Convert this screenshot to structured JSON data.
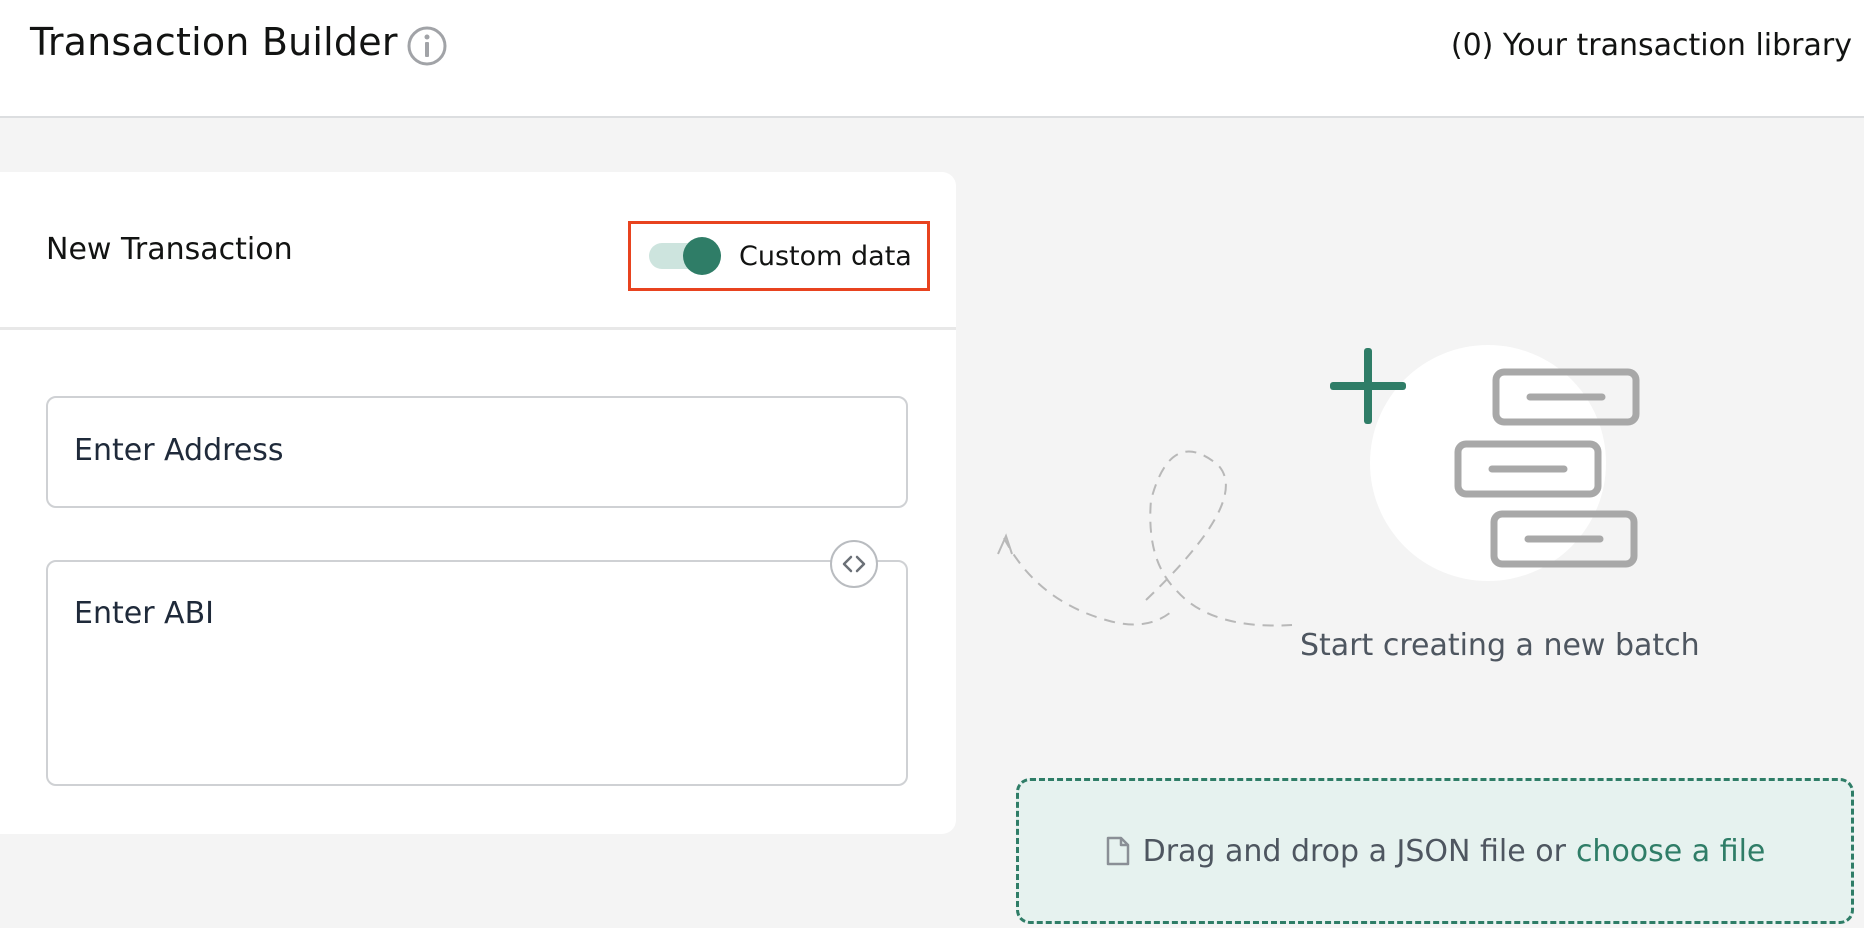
{
  "header": {
    "title": "Transaction Builder",
    "library_link": "(0) Your transaction library"
  },
  "transaction_card": {
    "title": "New Transaction",
    "toggle": {
      "label": "Custom data",
      "state": "on"
    },
    "address_placeholder": "Enter Address",
    "abi_placeholder": "Enter ABI"
  },
  "empty_state": {
    "message": "Start creating a new batch"
  },
  "dropzone": {
    "text": "Drag and drop a JSON file or",
    "link": "choose a file"
  },
  "colors": {
    "accent": "#2f7d67",
    "highlight_border": "#e8431f",
    "dropzone_bg": "#e6f2ef",
    "page_bg": "#f4f4f4"
  },
  "icons": [
    "info-icon",
    "code-icon",
    "plus-icon",
    "batch-list-icon",
    "file-icon"
  ]
}
